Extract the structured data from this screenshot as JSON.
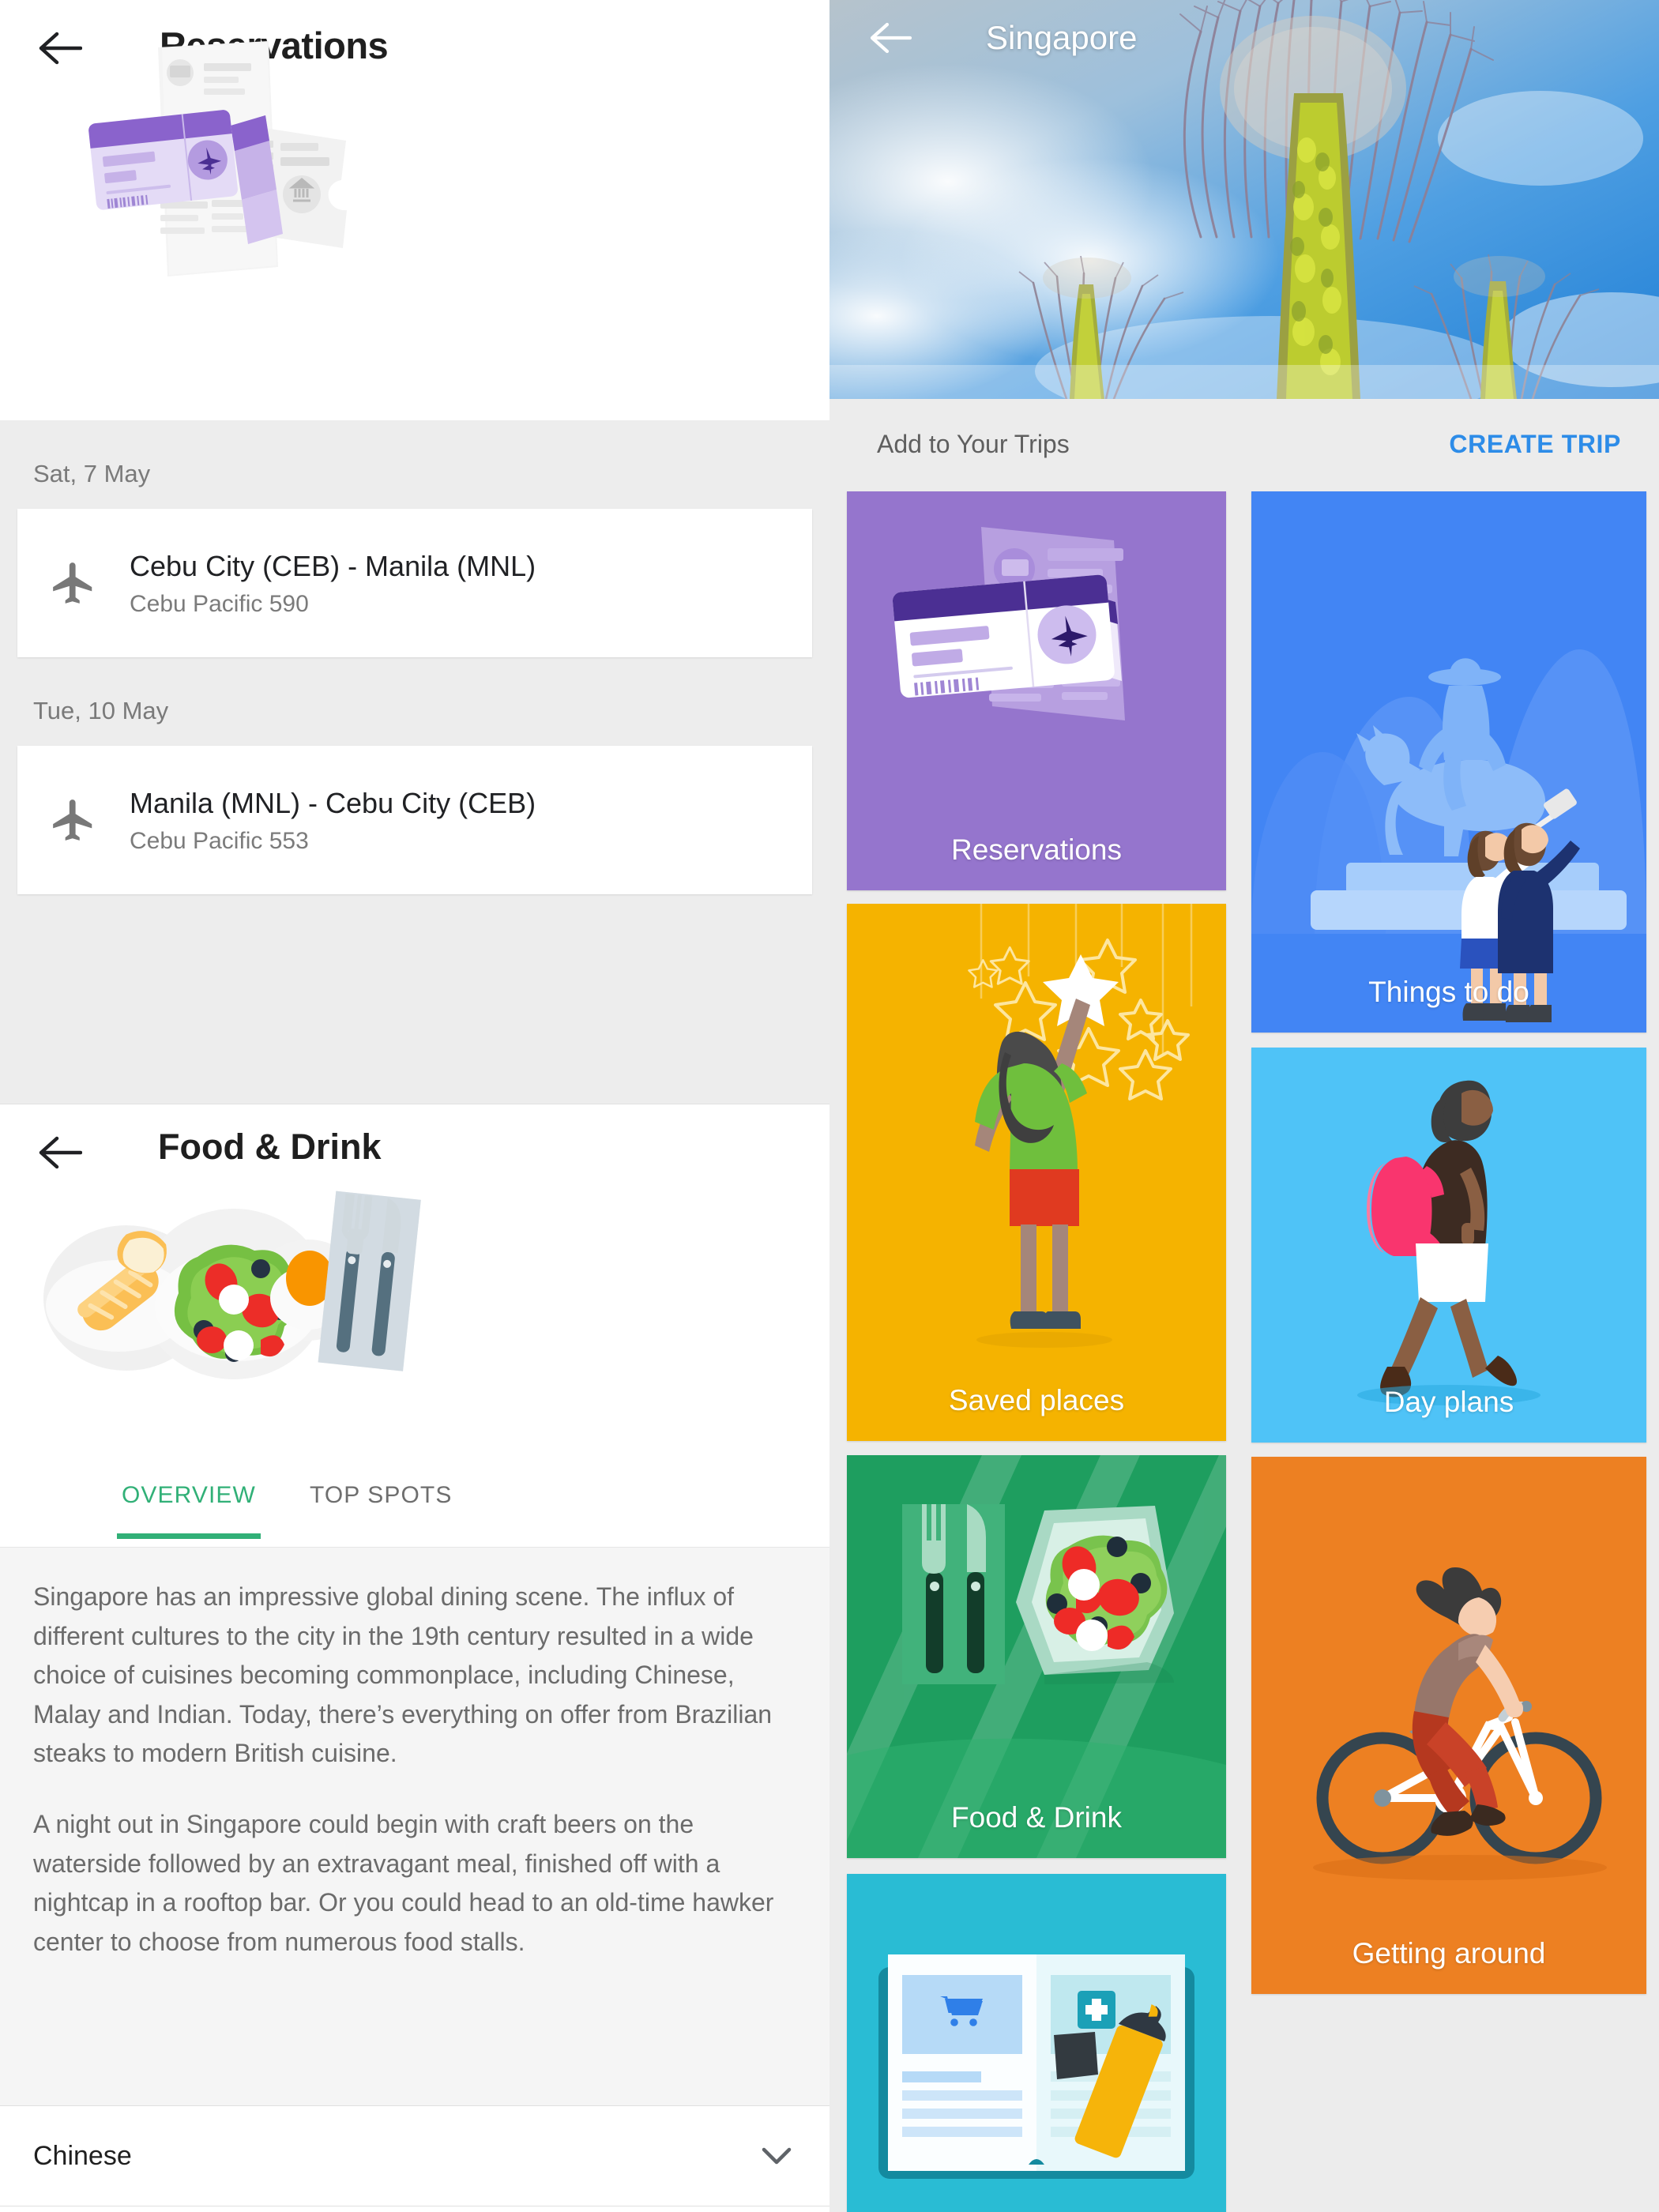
{
  "left_panel": {
    "reservations": {
      "title": "Reservations",
      "back_icon": "arrow-back-icon",
      "hero_icon": "boarding-pass-illustration",
      "groups": [
        {
          "date": "Sat, 7 May",
          "items": [
            {
              "icon": "airplane-icon",
              "route": "Cebu City (CEB) - Manila (MNL)",
              "airline": "Cebu Pacific 590"
            }
          ]
        },
        {
          "date": "Tue, 10 May",
          "items": [
            {
              "icon": "airplane-icon",
              "route": "Manila (MNL) - Cebu City (CEB)",
              "airline": "Cebu Pacific 553"
            }
          ]
        }
      ]
    },
    "food_drink": {
      "title": "Food & Drink",
      "back_icon": "arrow-back-icon",
      "hero_icon": "salad-plate-illustration",
      "tabs": [
        {
          "label": "OVERVIEW",
          "active": true
        },
        {
          "label": "TOP SPOTS",
          "active": false
        }
      ],
      "paragraphs": [
        "Singapore has an impressive global dining scene. The influx of different cultures to the city in the 19th century resulted in a wide choice of cuisines becoming commonplace, including Chinese, Malay and Indian. Today, there’s everything on offer from Brazilian steaks to modern British cuisine.",
        "A night out in Singapore could begin with craft beers on the waterside followed by an extravagant meal, finished off with a nightcap in a rooftop bar. Or you could head to an old-time hawker center to choose from numerous food stalls."
      ],
      "expander": {
        "label": "Chinese",
        "icon": "chevron-down-icon"
      }
    }
  },
  "right_panel": {
    "hero": {
      "title": "Singapore",
      "back_icon": "arrow-back-icon",
      "image": "supertree-grove-gardens-by-the-bay-photo"
    },
    "add_bar": {
      "label": "Add to Your Trips",
      "action_label": "CREATE TRIP"
    },
    "tiles": [
      {
        "label": "Reservations",
        "color": "#9575cd",
        "icon": "boarding-pass-illustration"
      },
      {
        "label": "Things to do",
        "color": "#4285f4",
        "icon": "statue-selfie-illustration"
      },
      {
        "label": "Saved places",
        "color": "#f5b300",
        "icon": "girl-reaching-star-illustration"
      },
      {
        "label": "Day plans",
        "color": "#4fc3f7",
        "icon": "walking-backpacker-illustration"
      },
      {
        "label": "Food & Drink",
        "color": "#1e9e5f",
        "icon": "salad-cutlery-illustration"
      },
      {
        "label": "Getting around",
        "color": "#ed8022",
        "icon": "cyclist-illustration"
      },
      {
        "label": "",
        "color": "#29bcd4",
        "icon": "open-guidebook-highlighter-illustration"
      }
    ]
  },
  "colors": {
    "accent_green": "#31b077",
    "link_blue": "#2d8ce8",
    "panel_gray": "#ededed",
    "body_gray": "#f5f5f5"
  }
}
